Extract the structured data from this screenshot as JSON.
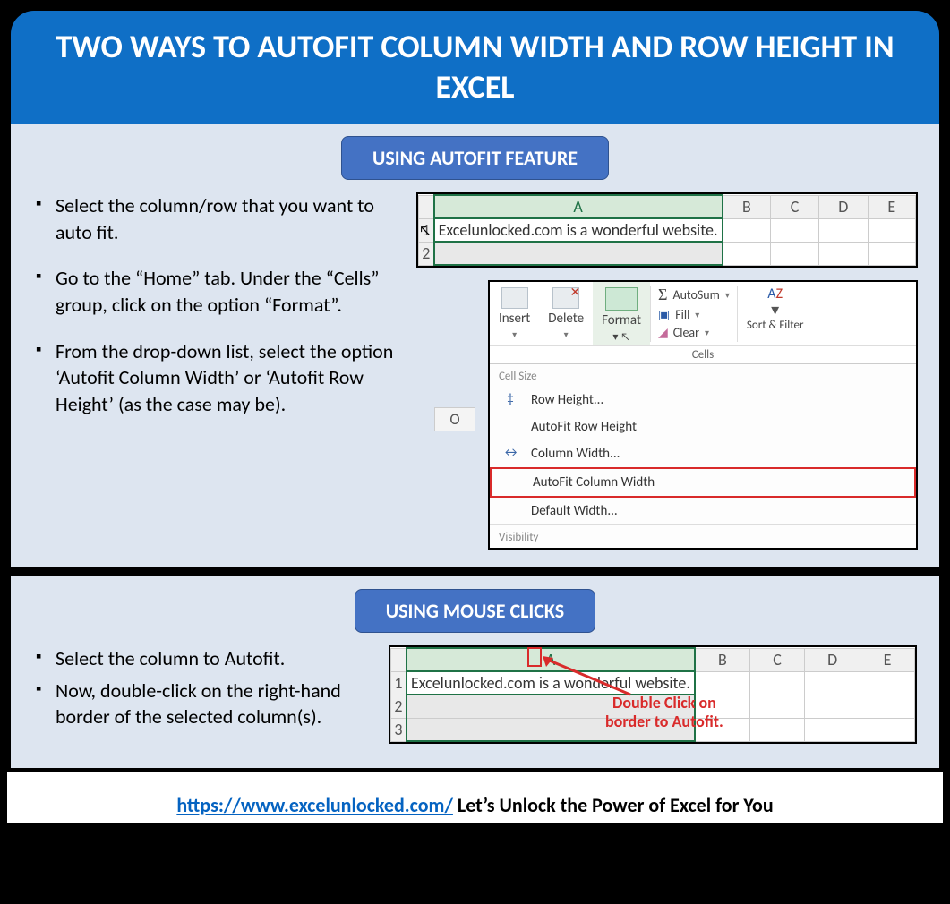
{
  "title": "TWO WAYS TO AUTOFIT COLUMN WIDTH AND ROW HEIGHT IN EXCEL",
  "section1": {
    "heading": "USING AUTOFIT FEATURE",
    "bullets": [
      "Select the column/row that you want to auto fit.",
      "Go to the “Home” tab. Under the “Cells” group, click on the option “Format”.",
      "From the drop-down list, select the option ‘Autofit Column Width’ or ‘Autofit Row Height’ (as the case may be)."
    ]
  },
  "section2": {
    "heading": "USING MOUSE CLICKS",
    "bullets": [
      "Select the column to Autofit.",
      "Now, double-click on the right-hand border of the selected column(s)."
    ]
  },
  "excel_grid": {
    "columns": [
      "A",
      "B",
      "C",
      "D",
      "E"
    ],
    "rows": [
      "1",
      "2"
    ],
    "rows3": [
      "1",
      "2",
      "3"
    ],
    "cell_text": "Excelunlocked.com is a wonderful website."
  },
  "ribbon": {
    "insert": "Insert",
    "delete": "Delete",
    "format": "Format",
    "cells_group": "Cells",
    "autosum": "AutoSum",
    "fill": "Fill",
    "clear": "Clear",
    "sort": "Sort & Filter",
    "o_col": "O",
    "dropdown_header": "Cell Size",
    "row_height": "Row Height...",
    "autofit_row": "AutoFit Row Height",
    "col_width": "Column Width...",
    "autofit_col": "AutoFit Column Width",
    "default_width": "Default Width...",
    "visibility": "Visibility"
  },
  "annotation": {
    "double_click_l1": "Double Click on",
    "double_click_l2": "border to Autofit."
  },
  "footer": {
    "url": "https://www.excelunlocked.com/",
    "tagline": " Let’s Unlock the Power of Excel for You"
  }
}
